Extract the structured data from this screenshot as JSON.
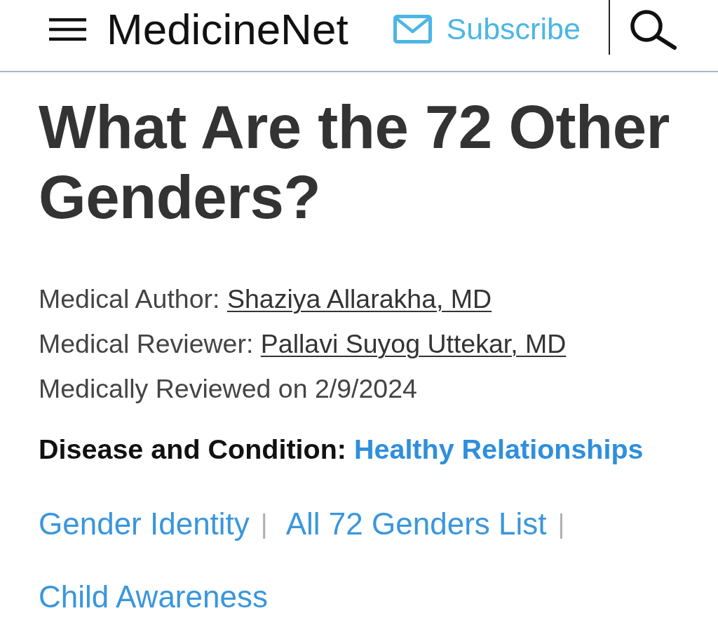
{
  "header": {
    "logo": "MedicineNet",
    "subscribe": "Subscribe"
  },
  "article": {
    "title": "What Are the 72 Other Genders?",
    "credits": [
      {
        "label": "Medical Author:",
        "name": "Shaziya Allarakha, MD"
      },
      {
        "label": "Medical Reviewer:",
        "name": "Pallavi Suyog Uttekar, MD"
      }
    ],
    "review_date": "Medically Reviewed on 2/9/2024",
    "category": {
      "label": "Disease and Condition:",
      "link": "Healthy Relationships"
    },
    "topics": [
      {
        "label": "Gender Identity",
        "separator": "|"
      },
      {
        "label": "All 72 Genders List",
        "separator": "|"
      },
      {
        "label": "Child Awareness"
      }
    ]
  }
}
